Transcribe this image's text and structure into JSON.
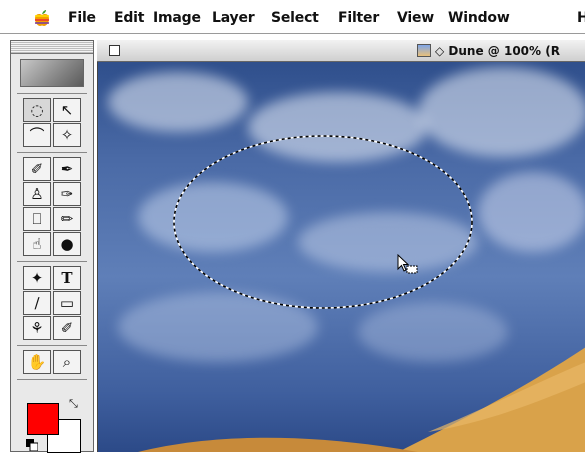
{
  "menubar": {
    "items": [
      "File",
      "Edit",
      "Image",
      "Layer",
      "Select",
      "Filter",
      "View",
      "Window",
      "H"
    ]
  },
  "document": {
    "title": "Dune @ 100% (R",
    "title_prefix_symbol": "◇"
  },
  "toolbox": {
    "tools": [
      {
        "name": "marquee-tool-icon",
        "glyph": "◌",
        "selected": true
      },
      {
        "name": "move-tool-icon",
        "glyph": "↖"
      },
      {
        "name": "lasso-tool-icon",
        "glyph": "⌒"
      },
      {
        "name": "magic-wand-tool-icon",
        "glyph": "✧"
      },
      {
        "name": "airbrush-tool-icon",
        "glyph": "✐"
      },
      {
        "name": "paintbrush-tool-icon",
        "glyph": "✒"
      },
      {
        "name": "rubber-stamp-tool-icon",
        "glyph": "♙"
      },
      {
        "name": "history-brush-tool-icon",
        "glyph": "✑"
      },
      {
        "name": "eraser-tool-icon",
        "glyph": "⎕"
      },
      {
        "name": "pencil-tool-icon",
        "glyph": "✏"
      },
      {
        "name": "blur-tool-icon",
        "glyph": "☝"
      },
      {
        "name": "burn-tool-icon",
        "glyph": "●"
      },
      {
        "name": "pen-tool-icon",
        "glyph": "✦"
      },
      {
        "name": "type-tool-icon",
        "glyph": "T"
      },
      {
        "name": "measure-tool-icon",
        "glyph": "∕"
      },
      {
        "name": "gradient-tool-icon",
        "glyph": "▭"
      },
      {
        "name": "paint-bucket-tool-icon",
        "glyph": "⚘"
      },
      {
        "name": "eyedropper-tool-icon",
        "glyph": "✐"
      },
      {
        "name": "hand-tool-icon",
        "glyph": "✋"
      },
      {
        "name": "zoom-tool-icon",
        "glyph": "⌕"
      }
    ]
  },
  "colors": {
    "foreground": "#ff0000",
    "background": "#ffffff",
    "sky_dark": "#2f4f8c",
    "sand": "#d9a24a"
  }
}
